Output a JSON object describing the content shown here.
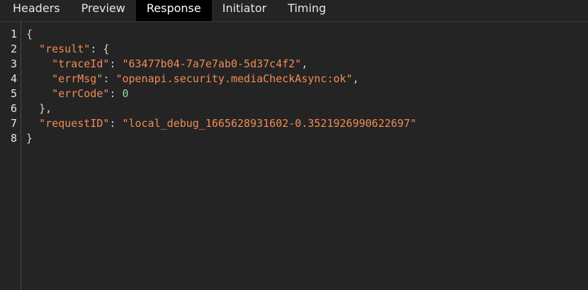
{
  "tabs": [
    {
      "label": "Headers",
      "active": false
    },
    {
      "label": "Preview",
      "active": false
    },
    {
      "label": "Response",
      "active": true
    },
    {
      "label": "Initiator",
      "active": false
    },
    {
      "label": "Timing",
      "active": false
    }
  ],
  "line_numbers": [
    "1",
    "2",
    "3",
    "4",
    "5",
    "6",
    "7",
    "8"
  ],
  "response": {
    "open_brace": "{",
    "result_key": "\"result\"",
    "trace_key": "\"traceId\"",
    "trace_value": "\"63477b04-7a7e7ab0-5d37c4f2\"",
    "errmsg_key": "\"errMsg\"",
    "errmsg_value": "\"openapi.security.mediaCheckAsync:ok\"",
    "errcode_key": "\"errCode\"",
    "errcode_value": "0",
    "close_result": "},",
    "requestid_key": "\"requestID\"",
    "requestid_value": "\"local_debug_1665628931602-0.3521926990622697\"",
    "close_brace": "}"
  },
  "colors": {
    "background": "#242424",
    "active_tab_bg": "#000000",
    "key_string": "#f28b54",
    "number": "#9ad5a8",
    "punctuation": "#d4d4d4"
  }
}
